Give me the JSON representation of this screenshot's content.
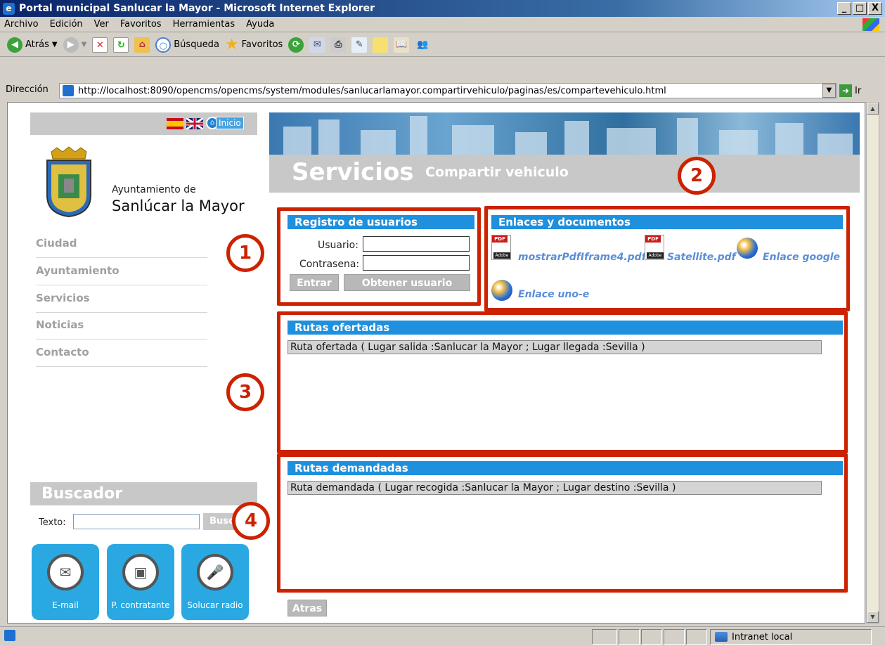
{
  "window": {
    "title": "Portal municipal Sanlucar la Mayor - Microsoft Internet Explorer",
    "min": "_",
    "max": "□",
    "close": "X"
  },
  "menu": [
    "Archivo",
    "Edición",
    "Ver",
    "Favoritos",
    "Herramientas",
    "Ayuda"
  ],
  "toolbar": {
    "back": "Atrás",
    "search": "Búsqueda",
    "favorites": "Favoritos"
  },
  "address": {
    "label": "Dirección",
    "url": "http://localhost:8090/opencms/opencms/system/modules/sanlucarlamayor.compartirvehiculo/paginas/es/compartevehiculo.html",
    "go": "Ir"
  },
  "status": {
    "zone": "Intranet local"
  },
  "sidebar": {
    "inicio": "Inicio",
    "ayto_pre": "Ayuntamiento de",
    "ayto_name": "Sanlúcar la Mayor",
    "nav": [
      "Ciudad",
      "Ayuntamiento",
      "Servicios",
      "Noticias",
      "Contacto"
    ],
    "buscador_title": "Buscador",
    "texto_label": "Texto:",
    "buscar": "Buscar",
    "big_buttons": [
      "E-mail",
      "P. contratante",
      "Solucar radio"
    ]
  },
  "header": {
    "title": "Servicios",
    "subtitle": "Compartir vehiculo"
  },
  "registro": {
    "title": "Registro de usuarios",
    "usuario_label": "Usuario:",
    "usuario_value": "",
    "contrasena_label": "Contrasena:",
    "contrasena_value": "",
    "entrar": "Entrar",
    "obtener": "Obtener usuario"
  },
  "enlaces": {
    "title": "Enlaces y documentos",
    "items": [
      "mostrarPdfIframe4.pdf",
      "Satellite.pdf",
      "Enlace google",
      "Enlace uno-e"
    ]
  },
  "ofertadas": {
    "title": "Rutas ofertadas",
    "rows": [
      "Ruta ofertada ( Lugar salida :Sanlucar la Mayor ; Lugar llegada :Sevilla )"
    ]
  },
  "demandadas": {
    "title": "Rutas demandadas",
    "rows": [
      "Ruta demandada ( Lugar recogida :Sanlucar la Mayor ; Lugar destino :Sevilla )"
    ]
  },
  "atras": "Atras",
  "markers": [
    "1",
    "2",
    "3",
    "4"
  ],
  "colors": {
    "annotation_red": "#cc2200",
    "section_blue": "#1e90dd",
    "sidebar_grey": "#c8c8c8",
    "link_blue": "#5b8ed6"
  }
}
